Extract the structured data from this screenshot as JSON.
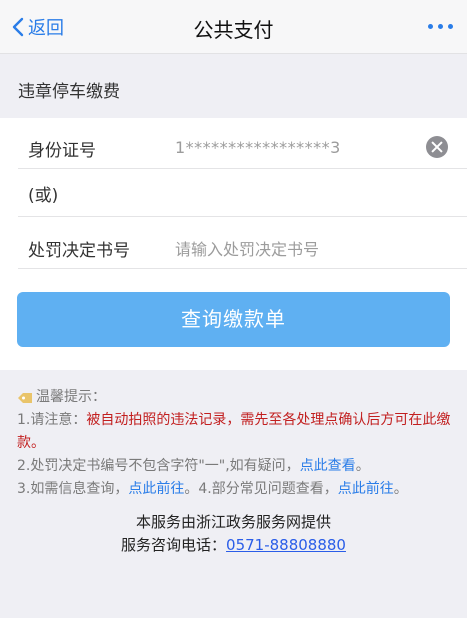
{
  "navbar": {
    "back_label": "返回",
    "title": "公共支付"
  },
  "section_title": "违章停车缴费",
  "form": {
    "id_label": "身份证号",
    "id_value": "1*****************3",
    "or_label": "(或)",
    "decision_label": "处罚决定书号",
    "decision_placeholder": "请输入处罚决定书号"
  },
  "query_button_label": "查询缴款单",
  "tips": {
    "header": "温馨提示：",
    "tip1_prefix": "1.请注意：",
    "tip1_red": "被自动拍照的违法记录，需先至各处理点确认后方可在此缴款。",
    "tip2_text": "2.处罚决定书编号不包含字符\"一\",如有疑问，",
    "tip2_link": "点此查看",
    "tip2_end": "。",
    "tip3_text": "3.如需信息查询，",
    "tip3_link": "点此前往",
    "tip4_text": "。4.部分常见问题查看，",
    "tip4_link": "点此前往",
    "tip4_end": "。"
  },
  "footer": {
    "provider": "本服务由浙江政务服务网提供",
    "hotline_label": "服务咨询电话：",
    "hotline_number": "0571-88808880"
  },
  "colors": {
    "accent": "#2a7de8",
    "button": "#5fb0f2",
    "warning": "#c21f1f",
    "background": "#efeff4"
  },
  "icons": [
    "chevron-left-icon",
    "more-icon",
    "clear-icon",
    "tag-icon"
  ]
}
